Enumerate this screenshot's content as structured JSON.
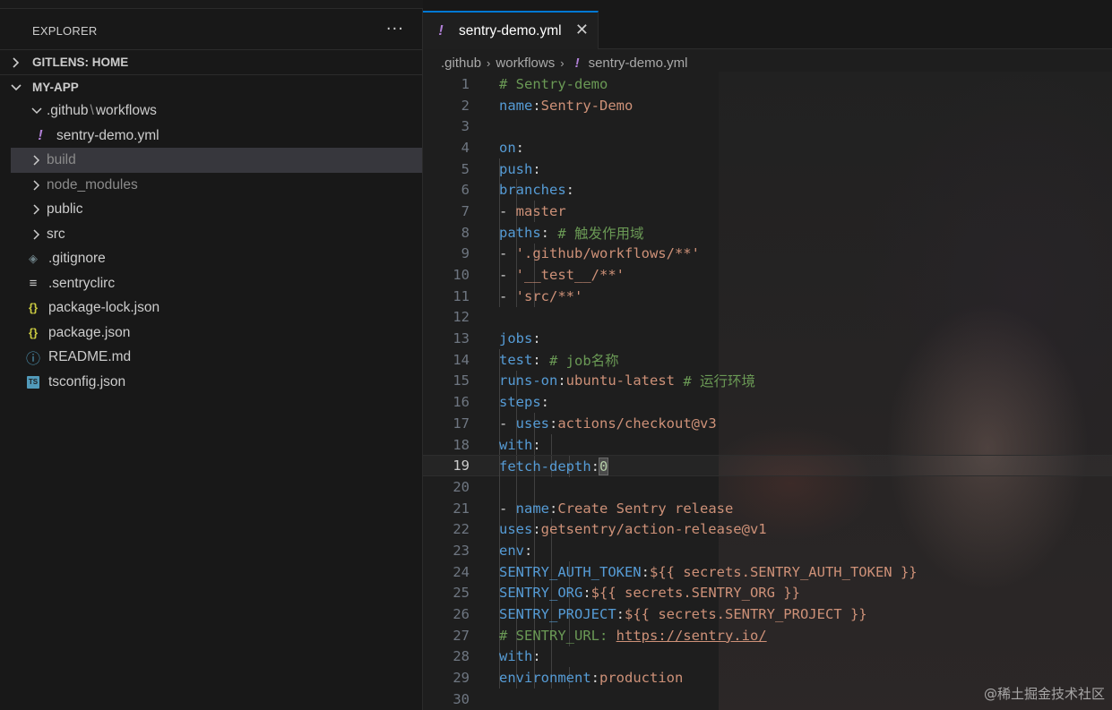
{
  "sidebar": {
    "header_title": "EXPLORER",
    "more_label": "···",
    "sections": {
      "gitlens": "GITLENS: HOME",
      "myapp": "MY-APP"
    },
    "tree": [
      {
        "label": "",
        "folder_a": ".github",
        "path_sep": "\\",
        "folder_b": "workflows",
        "kind": "folder-open"
      },
      {
        "label": "sentry-demo.yml",
        "kind": "yml",
        "icon": "!"
      },
      {
        "label": "build",
        "kind": "folder",
        "dim": true,
        "selected": true
      },
      {
        "label": "node_modules",
        "kind": "folder",
        "dim": true
      },
      {
        "label": "public",
        "kind": "folder"
      },
      {
        "label": "src",
        "kind": "folder"
      },
      {
        "label": ".gitignore",
        "kind": "git",
        "icon": "◈"
      },
      {
        "label": ".sentryclirc",
        "kind": "lines",
        "icon": "≡"
      },
      {
        "label": "package-lock.json",
        "kind": "json",
        "icon": "{}"
      },
      {
        "label": "package.json",
        "kind": "json",
        "icon": "{}"
      },
      {
        "label": "README.md",
        "kind": "info",
        "icon": "ⓘ"
      },
      {
        "label": "tsconfig.json",
        "kind": "ts",
        "icon": "TS"
      }
    ]
  },
  "editor": {
    "tab": {
      "icon": "!",
      "label": "sentry-demo.yml",
      "close": "✕"
    },
    "breadcrumb": {
      "part1": ".github",
      "part2": "workflows",
      "icon": "!",
      "part3": "sentry-demo.yml",
      "sep": "›"
    },
    "current_line": 19,
    "lines": [
      "# Sentry-demo",
      "name: Sentry-Demo",
      "",
      "on:",
      "  push:",
      "    branches:",
      "      - master",
      "    paths: # 触发作用域",
      "      - '.github/workflows/**'",
      "      - '__test__/**'",
      "      - 'src/**'",
      "",
      "jobs:",
      "  test: # job名称",
      "    runs-on: ubuntu-latest # 运行环境",
      "    steps:",
      "      - uses: actions/checkout@v3",
      "        with:",
      "          fetch-depth: 0",
      "",
      "      - name: Create Sentry release",
      "        uses: getsentry/action-release@v1",
      "        env:",
      "          SENTRY_AUTH_TOKEN: ${{ secrets.SENTRY_AUTH_TOKEN }}",
      "          SENTRY_ORG: ${{ secrets.SENTRY_ORG }}",
      "          SENTRY_PROJECT: ${{ secrets.SENTRY_PROJECT }}",
      "          # SENTRY_URL: https://sentry.io/",
      "        with:",
      "          environment: production",
      ""
    ]
  },
  "watermark": "@稀土掘金技术社区",
  "colors": {
    "accent": "#0078d4",
    "keyword": "#569cd6",
    "string": "#ce9178",
    "comment": "#6a9955",
    "yml_icon": "#b180d7"
  }
}
